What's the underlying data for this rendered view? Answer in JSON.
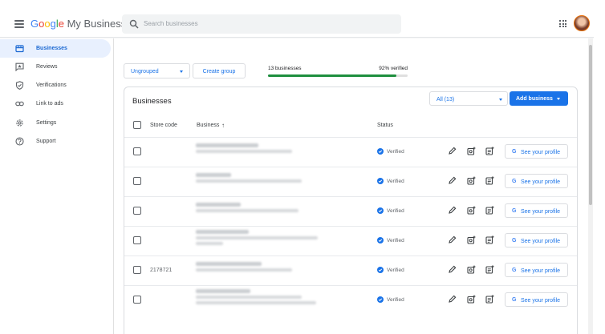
{
  "app": {
    "logo_google": [
      "G",
      "o",
      "o",
      "g",
      "l",
      "e"
    ],
    "logo_product": " My Business",
    "search_placeholder": "Search businesses"
  },
  "sidebar": {
    "items": [
      {
        "label": "Businesses",
        "icon": "storefront-icon",
        "active": true
      },
      {
        "label": "Reviews",
        "icon": "reviews-icon",
        "active": false
      },
      {
        "label": "Verifications",
        "icon": "shield-check-icon",
        "active": false
      },
      {
        "label": "Link to ads",
        "icon": "link-icon",
        "active": false
      },
      {
        "label": "Settings",
        "icon": "gear-icon",
        "active": false
      },
      {
        "label": "Support",
        "icon": "help-icon",
        "active": false
      }
    ]
  },
  "controls": {
    "group_select": "Ungrouped",
    "create_group": "Create group",
    "business_count": "13 businesses",
    "verified_pct_label": "92% verified",
    "verified_fraction": 0.92
  },
  "card": {
    "title": "Businesses",
    "filter": "All (13)",
    "add_business": "Add business",
    "columns": {
      "store_code": "Store code",
      "business": "Business",
      "sort_arrow": "↑",
      "status": "Status"
    },
    "rows": [
      {
        "store_code": "",
        "status": "Verified",
        "profile": "See your profile",
        "name_lines": 2
      },
      {
        "store_code": "",
        "status": "Verified",
        "profile": "See your profile",
        "name_lines": 2
      },
      {
        "store_code": "",
        "status": "Verified",
        "profile": "See your profile",
        "name_lines": 2
      },
      {
        "store_code": "",
        "status": "Verified",
        "profile": "See your profile",
        "name_lines": 3
      },
      {
        "store_code": "2178721",
        "status": "Verified",
        "profile": "See your profile",
        "name_lines": 2
      },
      {
        "store_code": "",
        "status": "Verified",
        "profile": "See your profile",
        "name_lines": 3
      }
    ]
  },
  "colors": {
    "accent": "#1a73e8",
    "progress": "#1e8e3e",
    "active_nav_bg": "#e8f0fe"
  }
}
